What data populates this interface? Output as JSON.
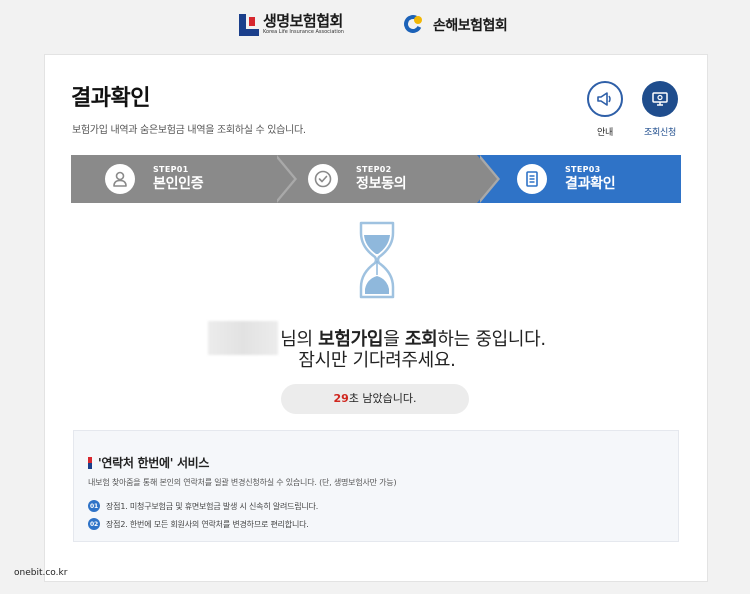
{
  "header": {
    "logo_life_ko": "생명보험협회",
    "logo_life_en": "Korea Life Insurance Association",
    "logo_nonlife_ko": "손해보험협회"
  },
  "page": {
    "title": "결과확인",
    "description": "보험가입 내역과 숨은보험금 내역을 조회하실 수 있습니다."
  },
  "quick_links": {
    "guide": {
      "label": "안내",
      "icon": "megaphone-icon"
    },
    "apply": {
      "label": "조회신청",
      "icon": "monitor-icon"
    }
  },
  "steps": [
    {
      "num": "STEP01",
      "name": "본인인증",
      "icon": "person-icon",
      "state": "done"
    },
    {
      "num": "STEP02",
      "name": "정보동의",
      "icon": "check-circle-icon",
      "state": "done"
    },
    {
      "num": "STEP03",
      "name": "결과확인",
      "icon": "document-icon",
      "state": "active"
    }
  ],
  "loading": {
    "suffix_nim": "님의 ",
    "bold_insurance": "보험가입",
    "particle_eul": "을 ",
    "bold_lookup": "조회",
    "tail": "하는 중입니다.",
    "line2": "잠시만 기다려주세요.",
    "seconds": "29",
    "seconds_suffix": "초 남았습니다."
  },
  "service": {
    "title": "'연락처 한번에' 서비스",
    "description": "내보험 찾아줌을 통해 본인의 연락처를 일괄 변경신청하실 수 있습니다. (단, 생명보험사만 가능)",
    "items": [
      {
        "num": "01",
        "text": "장점1. 미청구보험금 및 휴면보험금 발생 시 신속히 알려드립니다."
      },
      {
        "num": "02",
        "text": "장점2. 한번에 모든 회원사의 연락처를 변경하므로 편리합니다."
      }
    ]
  },
  "watermark": "onebit.co.kr",
  "colors": {
    "accent": "#2f73c7",
    "step_inactive": "#8a8a8a",
    "timer_seconds": "#d0271f",
    "navy": "#1f4d8d"
  }
}
